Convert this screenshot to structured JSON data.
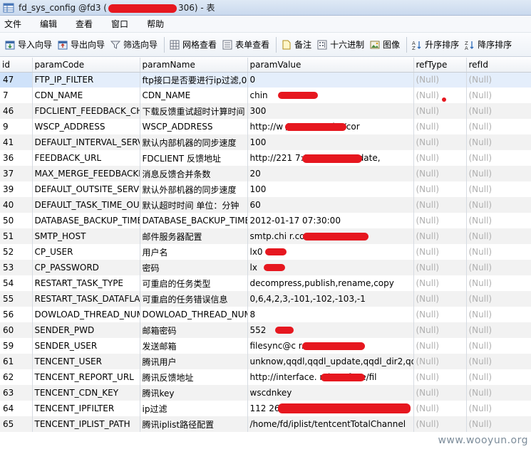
{
  "window": {
    "title_left": "fd_sys_config @fd3 (",
    "title_right": "306) - 表"
  },
  "menu": [
    "文件",
    "编辑",
    "查看",
    "窗口",
    "帮助"
  ],
  "toolbar": [
    {
      "label": "导入向导",
      "icon": "import-icon"
    },
    {
      "label": "导出向导",
      "icon": "export-icon"
    },
    {
      "label": "筛选向导",
      "icon": "filter-icon"
    },
    {
      "label": "网格查看",
      "icon": "grid-view-icon"
    },
    {
      "label": "表单查看",
      "icon": "form-view-icon"
    },
    {
      "label": "备注",
      "icon": "note-icon"
    },
    {
      "label": "十六进制",
      "icon": "hex-icon"
    },
    {
      "label": "图像",
      "icon": "image-icon"
    },
    {
      "label": "升序排序",
      "icon": "sort-asc-icon"
    },
    {
      "label": "降序排序",
      "icon": "sort-desc-icon"
    }
  ],
  "columns": [
    "id",
    "paramCode",
    "paramName",
    "paramValue",
    "refType",
    "refId"
  ],
  "rows": [
    [
      "47",
      "FTP_IP_FILTER",
      "ftp接口是否要进行ip过滤,0",
      "0",
      "(Null)",
      "(Null)"
    ],
    [
      "7",
      "CDN_NAME",
      "CDN_NAME",
      "chin",
      "(Null)",
      "(Null)"
    ],
    [
      "46",
      "FDCLIENT_FEEDBACK_CH",
      "下载反馈重试超时计算时间",
      "300",
      "(Null)",
      "(Null)"
    ],
    [
      "9",
      "WSCP_ADDRESS",
      "WSCP_ADDRESS",
      "http://w                    /wsCP/servlet/cor",
      "(Null)",
      "(Null)"
    ],
    [
      "41",
      "DEFAULT_INTERVAL_SERV",
      "默认内部机器的同步速度",
      "100",
      "(Null)",
      "(Null)"
    ],
    [
      "36",
      "FEEDBACK_URL",
      "FDCLIENT 反馈地址",
      "http://221                  7:9090/HttpUpdate,",
      "(Null)",
      "(Null)"
    ],
    [
      "37",
      "MAX_MERGE_FEEDBACKN",
      "消息反馈合并条数",
      "20",
      "(Null)",
      "(Null)"
    ],
    [
      "39",
      "DEFAULT_OUTSITE_SERVI",
      "默认外部机器的同步速度",
      "100",
      "(Null)",
      "(Null)"
    ],
    [
      "40",
      "DEFAULT_TASK_TIME_OU",
      "默认超时时间 单位：分钟",
      "60",
      "(Null)",
      "(Null)"
    ],
    [
      "50",
      "DATABASE_BACKUP_TIME",
      "DATABASE_BACKUP_TIME",
      "2012-01-17 07:30:00",
      "(Null)",
      "(Null)"
    ],
    [
      "51",
      "SMTP_HOST",
      "邮件服务器配置",
      "smtp.chi                    r.com",
      "(Null)",
      "(Null)"
    ],
    [
      "52",
      "CP_USER",
      "用户名",
      "lx0",
      "(Null)",
      "(Null)"
    ],
    [
      "53",
      "CP_PASSWORD",
      "密码",
      "lx",
      "(Null)",
      "(Null)"
    ],
    [
      "54",
      "RESTART_TASK_TYPE",
      "可重启的任务类型",
      "decompress,publish,rename,copy",
      "(Null)",
      "(Null)"
    ],
    [
      "55",
      "RESTART_TASK_DATAFLAC",
      "可重启的任务错误信息",
      "0,6,4,2,3,-101,-102,-103,-1",
      "(Null)",
      "(Null)"
    ],
    [
      "56",
      "DOWLOAD_THREAD_NUM",
      "DOWLOAD_THREAD_NUM",
      "8",
      "(Null)",
      "(Null)"
    ],
    [
      "60",
      "SENDER_PWD",
      "邮箱密码",
      "552",
      "(Null)",
      "(Null)"
    ],
    [
      "59",
      "SENDER_USER",
      "发送邮箱",
      "filesync@c                    r.com",
      "(Null)",
      "(Null)"
    ],
    [
      "61",
      "TENCENT_USER",
      "腾讯用户",
      "unknow,qqdl,qqdl_update,qqdl_dir2,qq",
      "(Null)",
      "(Null)"
    ],
    [
      "62",
      "TENCENT_REPORT_URL",
      "腾讯反馈地址",
      "http://interface.           n/interface/fil",
      "(Null)",
      "(Null)"
    ],
    [
      "63",
      "TENCENT_CDN_KEY",
      "腾讯key",
      "wscdnkey",
      "(Null)",
      "(Null)"
    ],
    [
      "64",
      "TENCENT_IPFILTER",
      "ip过滤",
      "112                                    26",
      "(Null)",
      "(Null)"
    ],
    [
      "65",
      "TENCENT_IPLIST_PATH",
      "腾讯iplist路径配置",
      "/home/fd/iplist/tentcentTotalChannel",
      "(Null)",
      "(Null)"
    ]
  ],
  "watermark": "www.wooyun.org",
  "colors": {
    "redaction": "#e6171f",
    "null_text": "#b0b0b0",
    "selected_row": "#e4eefb"
  }
}
